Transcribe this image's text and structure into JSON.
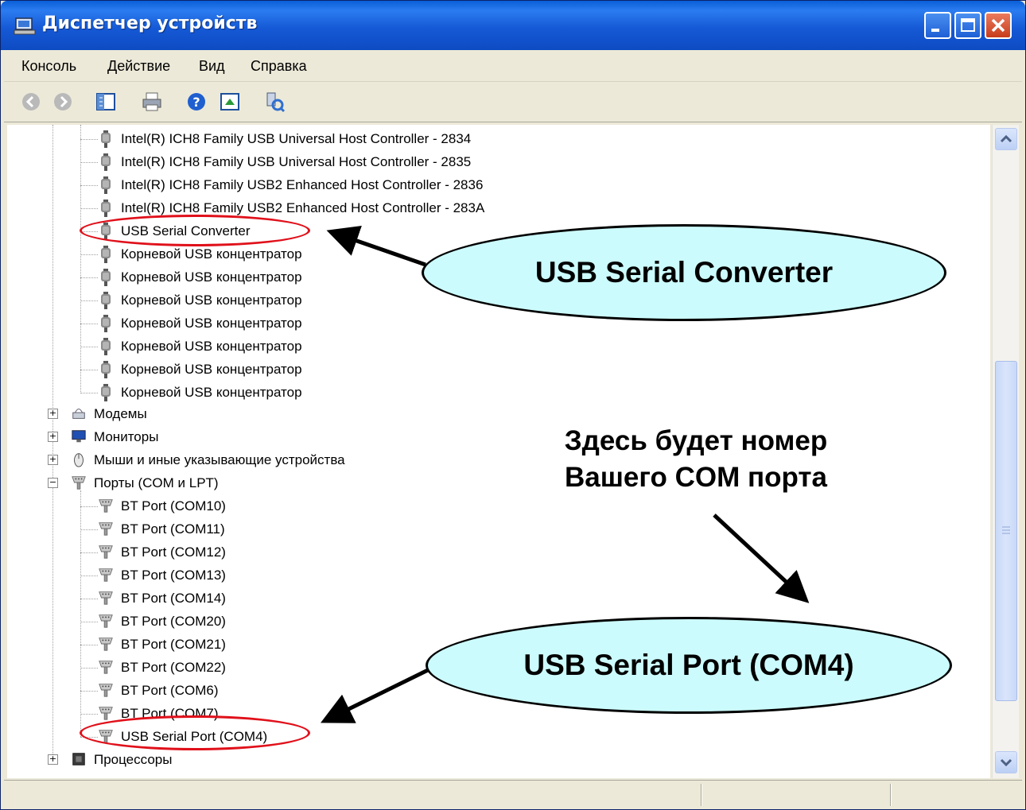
{
  "window": {
    "title": "Диспетчер устройств"
  },
  "menu": {
    "items": [
      "Консоль",
      "Действие",
      "Вид",
      "Справка"
    ]
  },
  "toolbar": {
    "icons": [
      "back-icon",
      "forward-icon",
      "console-tree-icon",
      "print-icon",
      "help-icon",
      "properties-icon",
      "scan-hardware-icon"
    ]
  },
  "tree": {
    "usb_controllers": [
      "Intel(R) ICH8 Family USB Universal Host Controller - 2834",
      "Intel(R) ICH8 Family USB Universal Host Controller - 2835",
      "Intel(R) ICH8 Family USB2 Enhanced Host Controller - 2836",
      "Intel(R) ICH8 Family USB2 Enhanced Host Controller - 283A",
      "USB Serial Converter",
      "Корневой USB концентратор",
      "Корневой USB концентратор",
      "Корневой USB концентратор",
      "Корневой USB концентратор",
      "Корневой USB концентратор",
      "Корневой USB концентратор",
      "Корневой USB концентратор"
    ],
    "categories": {
      "modems": "Модемы",
      "monitors": "Мониторы",
      "mice": "Мыши и иные указывающие устройства",
      "ports": "Порты (COM и LPT)",
      "processors": "Процессоры"
    },
    "ports": [
      "BT Port (COM10)",
      "BT Port (COM11)",
      "BT Port (COM12)",
      "BT Port (COM13)",
      "BT Port (COM14)",
      "BT Port (COM20)",
      "BT Port (COM21)",
      "BT Port (COM22)",
      "BT Port (COM6)",
      "BT Port (COM7)",
      "USB Serial Port (COM4)"
    ]
  },
  "annotations": {
    "callout_converter": "USB Serial Converter",
    "callout_port": "USB Serial Port (COM4)",
    "note_line1": "Здесь будет номер",
    "note_line2": "Вашего COM порта"
  },
  "colors": {
    "titlebar": "#1659d6",
    "callout_fill": "#ccfbfd",
    "highlight_oval": "#e0101a"
  }
}
